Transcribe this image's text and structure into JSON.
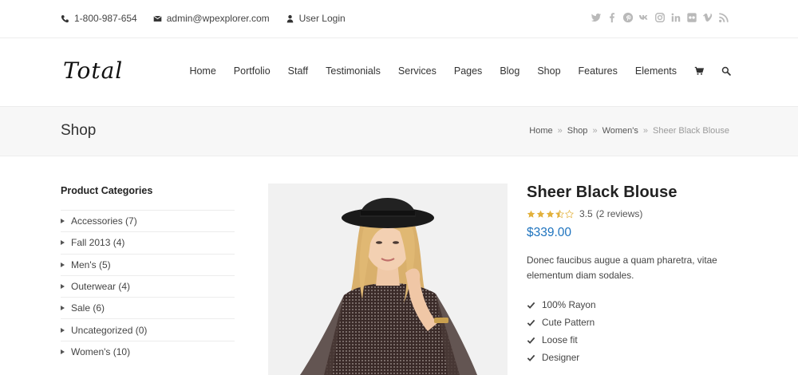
{
  "topbar": {
    "phone": "1-800-987-654",
    "email": "admin@wpexplorer.com",
    "login": "User Login",
    "social_icons": [
      "twitter-icon",
      "facebook-icon",
      "pinterest-icon",
      "vk-icon",
      "instagram-icon",
      "linkedin-icon",
      "flickr-icon",
      "vimeo-icon",
      "rss-icon"
    ]
  },
  "header": {
    "logo": "Total",
    "nav": [
      "Home",
      "Portfolio",
      "Staff",
      "Testimonials",
      "Services",
      "Pages",
      "Blog",
      "Shop",
      "Features",
      "Elements"
    ],
    "nav_icons": [
      "cart-icon",
      "search-icon"
    ]
  },
  "page_header": {
    "title": "Shop",
    "breadcrumbs": [
      "Home",
      "Shop",
      "Women's"
    ],
    "breadcrumb_current": "Sheer Black Blouse",
    "separator": "»"
  },
  "sidebar": {
    "heading": "Product Categories",
    "categories": [
      "Accessories (7)",
      "Fall 2013 (4)",
      "Men's (5)",
      "Outerwear (4)",
      "Sale (6)",
      "Uncategorized (0)",
      "Women's (10)"
    ]
  },
  "product": {
    "name": "Sheer Black Blouse",
    "rating_value": "3.5",
    "reviews": "(2 reviews)",
    "rating_stars": 3.5,
    "price": "$339.00",
    "description": "Donec faucibus augue a quam pharetra, vitae elementum diam sodales.",
    "features": [
      "100% Rayon",
      "Cute Pattern",
      "Loose fit",
      "Designer"
    ]
  },
  "colors": {
    "price": "#1e73be",
    "star": "#e2b13c",
    "icon_gray": "#b9b9b9"
  }
}
